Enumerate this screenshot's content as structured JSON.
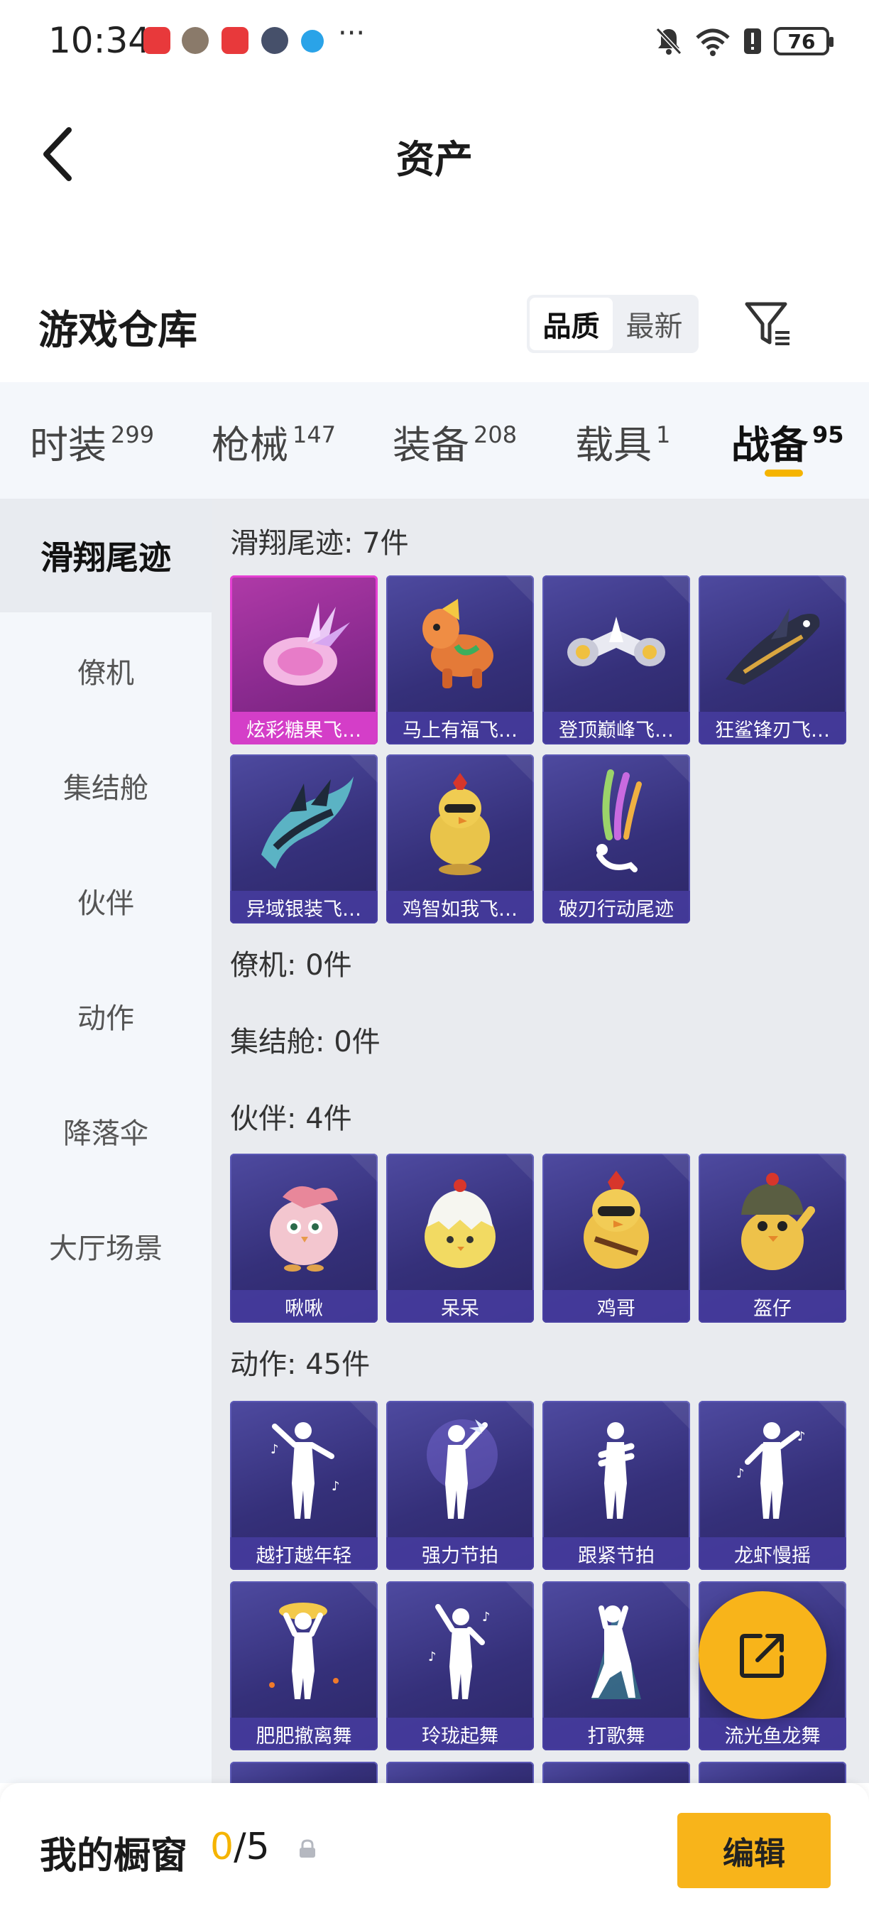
{
  "status_bar": {
    "time": "10:34",
    "more": "···",
    "battery": "76"
  },
  "header": {
    "title": "资产"
  },
  "section": {
    "title": "游戏仓库",
    "sort_options": [
      "品质",
      "最新"
    ],
    "active_sort": "品质"
  },
  "tabs": [
    {
      "label": "时装",
      "count": "299"
    },
    {
      "label": "枪械",
      "count": "147"
    },
    {
      "label": "装备",
      "count": "208"
    },
    {
      "label": "载具",
      "count": "1"
    },
    {
      "label": "战备",
      "count": "95",
      "active": true
    }
  ],
  "sidebar": [
    "滑翔尾迹",
    "僚机",
    "集结舱",
    "伙伴",
    "动作",
    "降落伞",
    "大厅场景"
  ],
  "groups": {
    "gliding": {
      "title": "滑翔尾迹: 7件",
      "items": [
        "炫彩糖果飞…",
        "马上有福飞…",
        "登顶巅峰飞…",
        "狂鲨锋刃飞…",
        "异域银装飞…",
        "鸡智如我飞…",
        "破刃行动尾迹"
      ]
    },
    "wingman": {
      "title": "僚机: 0件"
    },
    "pod": {
      "title": "集结舱: 0件"
    },
    "partner": {
      "title": "伙伴: 4件",
      "items": [
        "啾啾",
        "呆呆",
        "鸡哥",
        "盔仔"
      ]
    },
    "emote": {
      "title": "动作: 45件",
      "items": [
        "越打越年轻",
        "强力节拍",
        "跟紧节拍",
        "龙虾慢摇",
        "肥肥撤离舞",
        "玲珑起舞",
        "打歌舞",
        "流光鱼龙舞"
      ]
    }
  },
  "bottom": {
    "title": "我的橱窗",
    "count_current": "0",
    "count_total": "/5",
    "edit_label": "编辑"
  },
  "colors": {
    "accent": "#f8b41a",
    "card_bg": "#3b3585",
    "card_pink": "#d43ec8"
  }
}
